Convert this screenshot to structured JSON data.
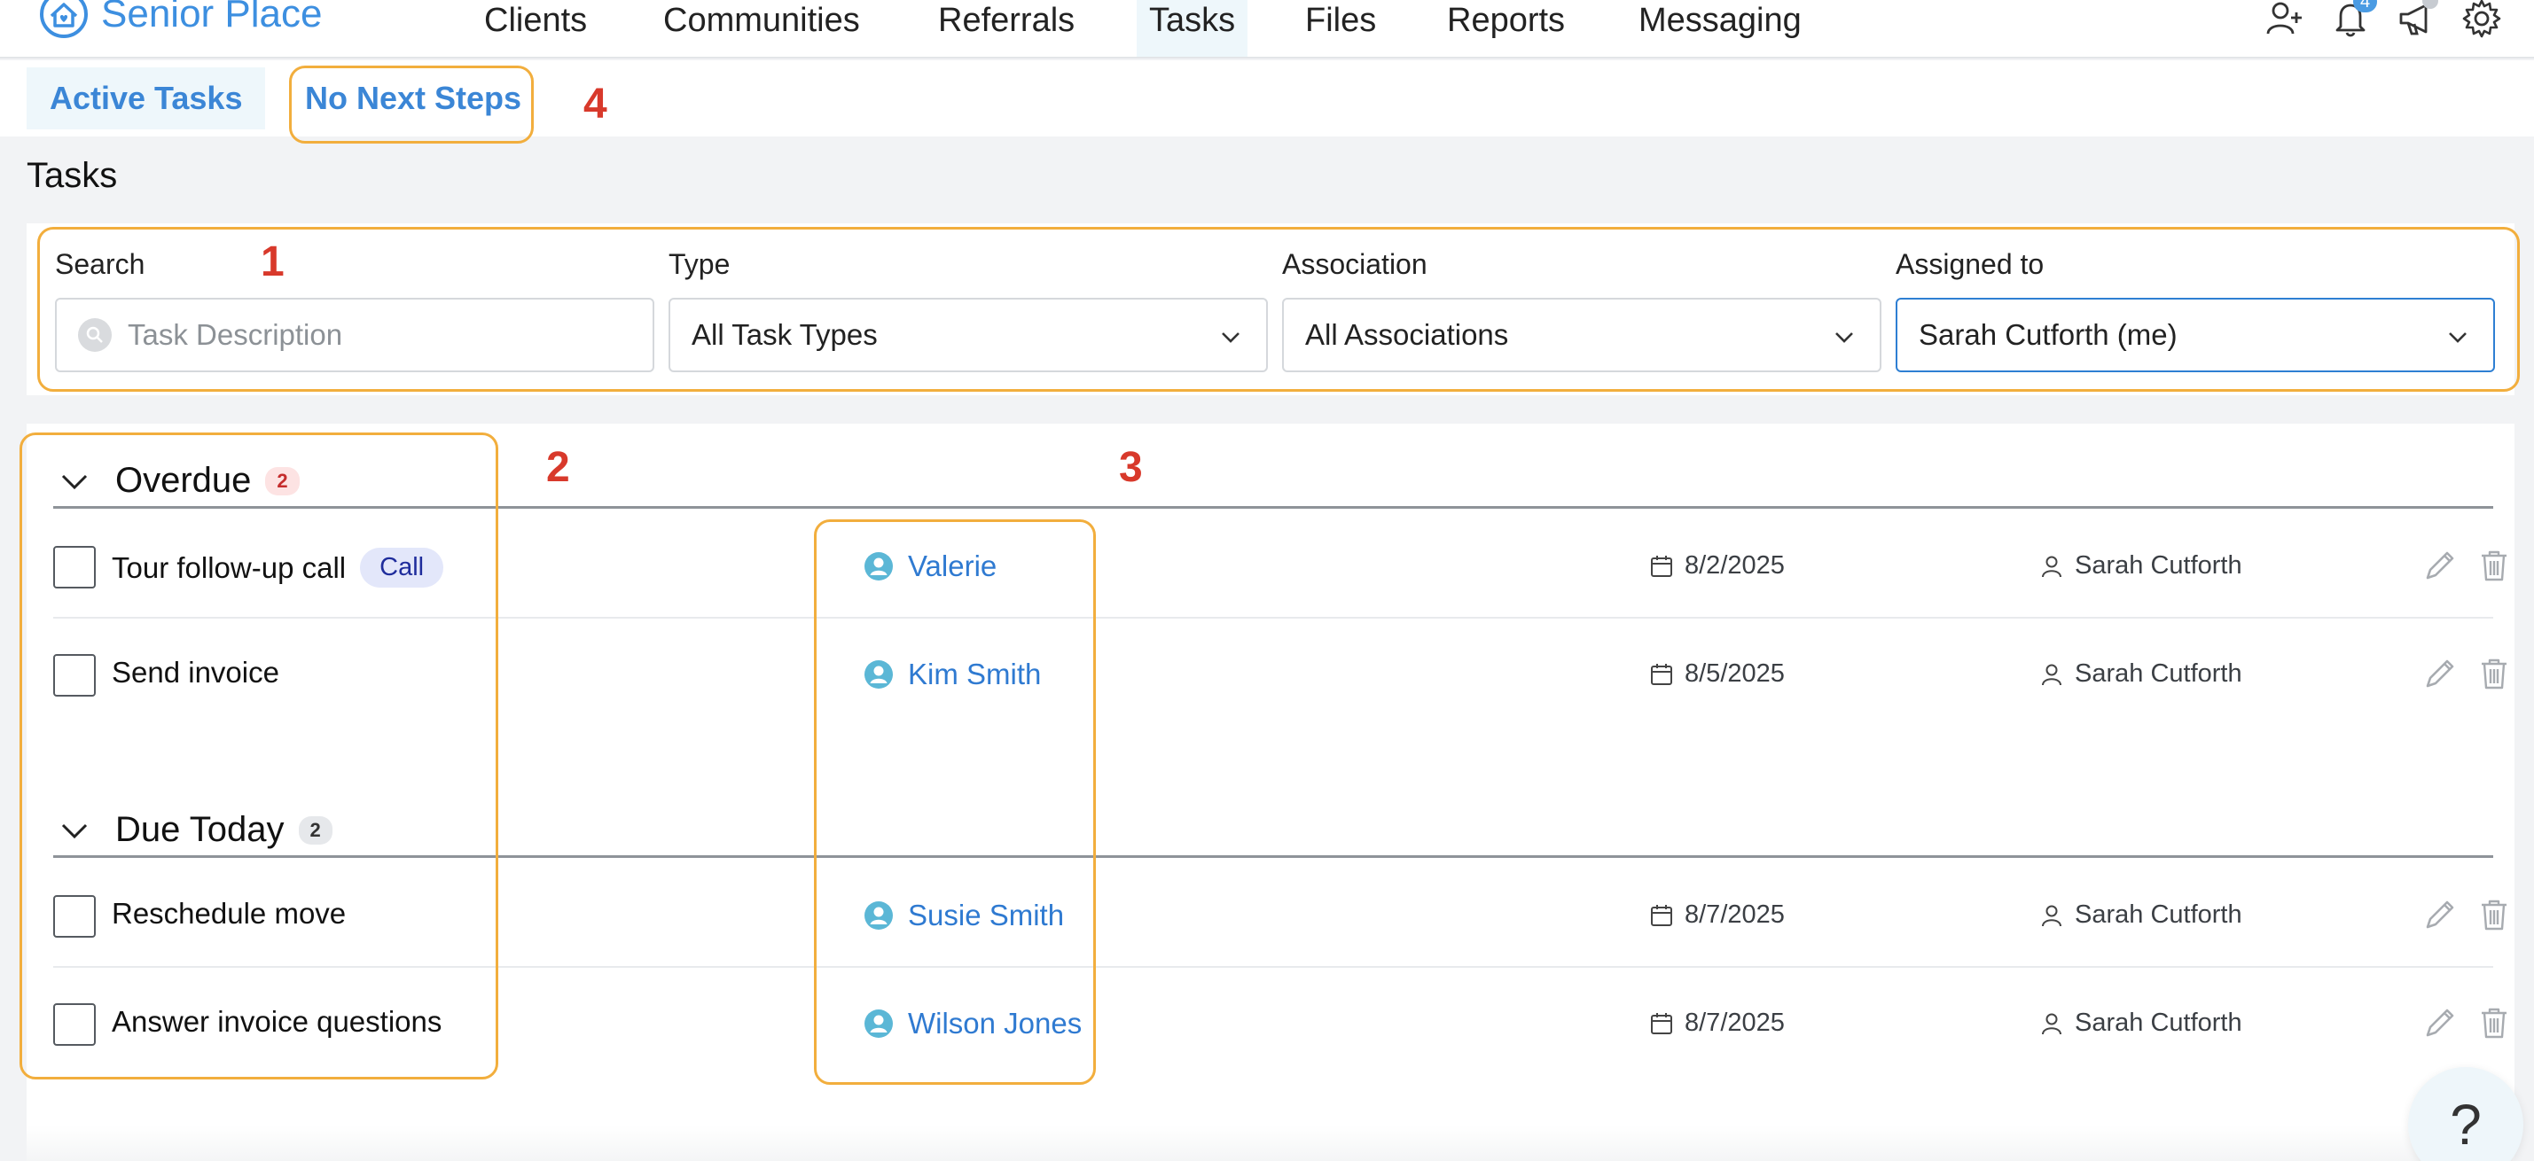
{
  "brand": {
    "name": "Senior Place"
  },
  "nav": {
    "items": [
      {
        "label": "Clients",
        "active": false
      },
      {
        "label": "Communities",
        "active": false
      },
      {
        "label": "Referrals",
        "active": false
      },
      {
        "label": "Tasks",
        "active": true
      },
      {
        "label": "Files",
        "active": false
      },
      {
        "label": "Reports",
        "active": false
      },
      {
        "label": "Messaging",
        "active": false
      }
    ],
    "notification_count": "4",
    "icons": [
      "add-user-icon",
      "bell-icon",
      "megaphone-icon",
      "gear-icon"
    ]
  },
  "subtabs": [
    {
      "label": "Active Tasks",
      "active": true
    },
    {
      "label": "No Next Steps",
      "active": false
    }
  ],
  "annotations": [
    "1",
    "2",
    "3",
    "4"
  ],
  "page_title": "Tasks",
  "filters": {
    "search": {
      "label": "Search",
      "placeholder": "Task Description",
      "value": ""
    },
    "type": {
      "label": "Type",
      "value": "All Task Types"
    },
    "association": {
      "label": "Association",
      "value": "All Associations"
    },
    "assigned": {
      "label": "Assigned to",
      "value": "Sarah Cutforth (me)"
    }
  },
  "sections": [
    {
      "title": "Overdue",
      "count": "2",
      "tasks": [
        {
          "description": "Tour follow-up call",
          "type": "Call",
          "association": "Valerie",
          "due": "8/2/2025",
          "assignee": "Sarah Cutforth"
        },
        {
          "description": "Send invoice",
          "type": "",
          "association": "Kim Smith",
          "due": "8/5/2025",
          "assignee": "Sarah Cutforth"
        }
      ]
    },
    {
      "title": "Due Today",
      "count": "2",
      "tasks": [
        {
          "description": "Reschedule move",
          "type": "",
          "association": "Susie Smith",
          "due": "8/7/2025",
          "assignee": "Sarah Cutforth"
        },
        {
          "description": "Answer invoice questions",
          "type": "",
          "association": "Wilson Jones",
          "due": "8/7/2025",
          "assignee": "Sarah Cutforth"
        }
      ]
    }
  ],
  "help": {
    "label": "?"
  },
  "colors": {
    "brand": "#3d8fe0",
    "link": "#2f7ad1",
    "highlight": "#f2ae3d",
    "annotation": "#d8392b",
    "overdue_badge": "#fde3e3"
  }
}
